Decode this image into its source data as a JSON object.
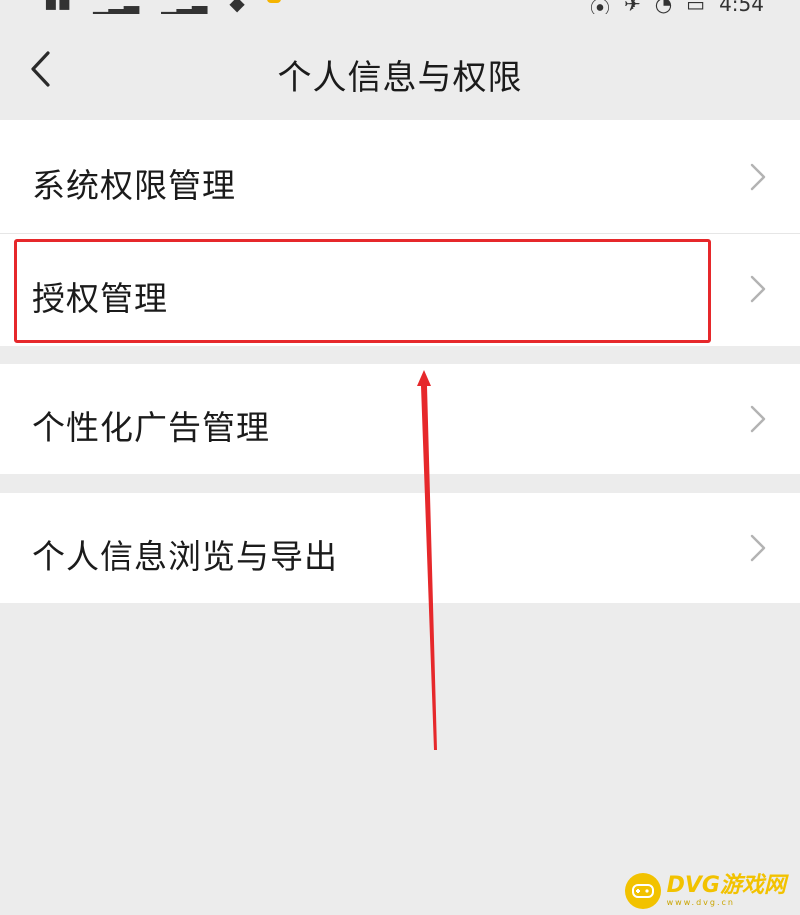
{
  "status_bar": {
    "left_glyphs": [
      "▪▪",
      "▁▂▃",
      "▁▂▃",
      "◆"
    ],
    "right_glyphs": [
      "⦿",
      "✈",
      "◔",
      "▭",
      "⟫"
    ],
    "time": "4:54"
  },
  "header": {
    "title": "个人信息与权限",
    "back_icon": "chevron-left-icon"
  },
  "menu": {
    "items": [
      {
        "label": "系统权限管理"
      },
      {
        "label": "授权管理"
      },
      {
        "label": "个性化广告管理"
      },
      {
        "label": "个人信息浏览与导出"
      }
    ]
  },
  "annotation": {
    "highlight_color": "#e6282b",
    "highlighted_item": "授权管理"
  },
  "watermark": {
    "name": "DVG游戏网",
    "sub": "www.dvg.cn"
  },
  "colors": {
    "background": "#ececec",
    "row_background": "#ffffff",
    "text": "#1b1b1b",
    "chevron": "#b3b3b3",
    "accent_watermark": "#f2c200"
  }
}
